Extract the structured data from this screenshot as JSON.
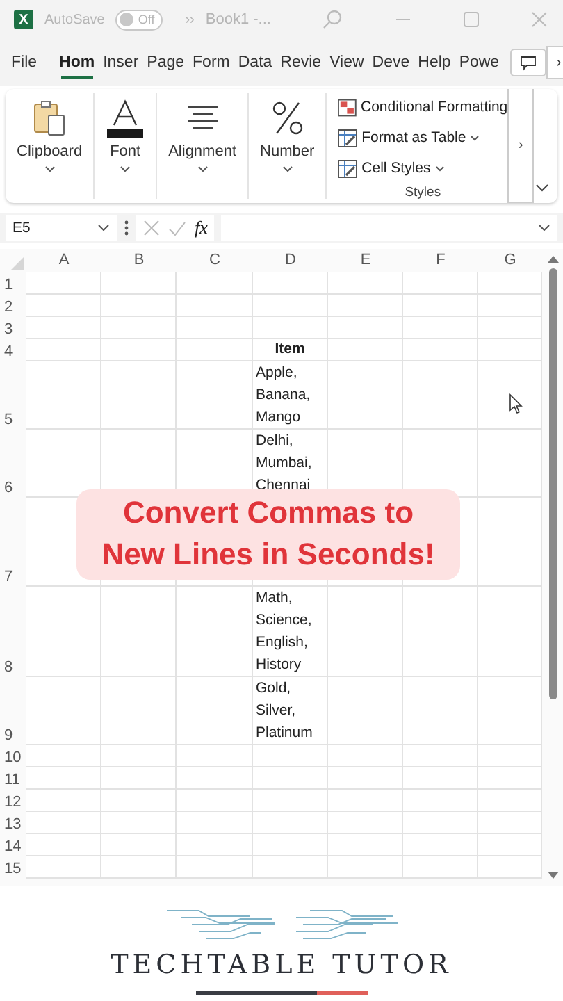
{
  "title_bar": {
    "app_icon": "X",
    "autosave_label": "AutoSave",
    "autosave": {
      "on": false,
      "label": "Off"
    },
    "more": "››",
    "document_title": "Book1 -..."
  },
  "tabs": [
    {
      "label": "File",
      "selected": false
    },
    {
      "label": "Hom",
      "selected": true
    },
    {
      "label": "Inser",
      "selected": false
    },
    {
      "label": "Page",
      "selected": false
    },
    {
      "label": "Form",
      "selected": false
    },
    {
      "label": "Data",
      "selected": false
    },
    {
      "label": "Revie",
      "selected": false
    },
    {
      "label": "View",
      "selected": false
    },
    {
      "label": "Deve",
      "selected": false
    },
    {
      "label": "Help",
      "selected": false
    },
    {
      "label": "Powe",
      "selected": false
    }
  ],
  "tab_scroll": "›",
  "ribbon": {
    "groups": [
      {
        "label": "Clipboard",
        "kind": "clipboard"
      },
      {
        "label": "Font",
        "kind": "font"
      },
      {
        "label": "Alignment",
        "kind": "alignment"
      },
      {
        "label": "Number",
        "kind": "number"
      }
    ],
    "styles": {
      "label": "Styles",
      "items": [
        {
          "label": "Conditional Formatting",
          "kind": "conditional",
          "dropdown": false
        },
        {
          "label": "Format as Table",
          "kind": "table",
          "dropdown": true
        },
        {
          "label": "Cell Styles",
          "kind": "cellstyles",
          "dropdown": true
        }
      ]
    },
    "scroll": "›"
  },
  "formula_bar": {
    "name_box": "E5",
    "function_label": "fx"
  },
  "sheet": {
    "columns": [
      "A",
      "B",
      "C",
      "D",
      "E",
      "F",
      "G"
    ],
    "rows": [
      {
        "number": "1",
        "kind": "plain"
      },
      {
        "number": "2",
        "kind": "plain"
      },
      {
        "number": "3",
        "kind": "plain"
      },
      {
        "number": "4",
        "kind": "heading",
        "item": "Item"
      },
      {
        "number": "5",
        "kind": "wrapped",
        "item": "Apple,\nBanana,\nMango"
      },
      {
        "number": "6",
        "kind": "wrapped",
        "item": "Delhi,\nMumbai,\nChennai"
      },
      {
        "number": "7",
        "kind": "tall"
      },
      {
        "number": "8",
        "kind": "wrapped",
        "item": "Math,\nScience,\nEnglish,\nHistory"
      },
      {
        "number": "9",
        "kind": "wrapped",
        "item": "Gold,\nSilver,\nPlatinum"
      },
      {
        "number": "10",
        "kind": "plain"
      },
      {
        "number": "11",
        "kind": "plain"
      },
      {
        "number": "12",
        "kind": "plain"
      },
      {
        "number": "13",
        "kind": "plain"
      },
      {
        "number": "14",
        "kind": "plain"
      },
      {
        "number": "15",
        "kind": "plain"
      }
    ]
  },
  "caption": "Convert Commas to\nNew Lines in Seconds!",
  "brand": "TECHTABLE TUTOR"
}
